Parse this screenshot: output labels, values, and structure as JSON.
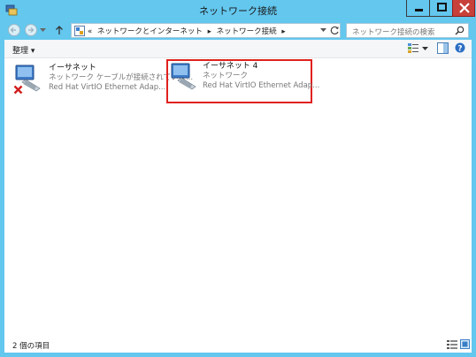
{
  "window": {
    "title": "ネットワーク接続"
  },
  "nav": {
    "breadcrumb": [
      "«",
      "ネットワークとインターネット",
      "▸",
      "ネットワーク接続",
      "▸"
    ],
    "search_placeholder": "ネットワーク接続の検索"
  },
  "toolbar": {
    "organize_label": "整理 ▾"
  },
  "items": [
    {
      "name": "イーサネット",
      "status": "ネットワーク ケーブルが接続されていま...",
      "device": "Red Hat VirtIO Ethernet Adap...",
      "disconnected": true
    },
    {
      "name": "イーサネット 4",
      "status": "ネットワーク",
      "device": "Red Hat VirtIO Ethernet Adap...",
      "disconnected": false
    }
  ],
  "statusbar": {
    "count_text": "2 個の項目"
  },
  "colors": {
    "frame": "#63c7ee",
    "close": "#c7403a",
    "highlight": "#e0211c"
  }
}
